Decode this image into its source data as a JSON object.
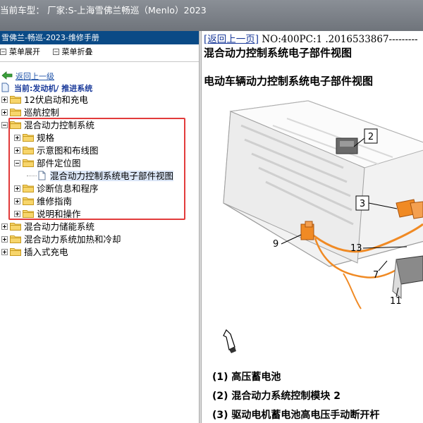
{
  "topbar": {
    "text": "当前车型： 厂家:S-上海雪佛兰畅巡（Menlo）2023"
  },
  "left": {
    "header": "雪佛兰-畅巡-2023-维修手册",
    "menu": {
      "expand": "菜单展开",
      "collapse": "菜单折叠"
    },
    "back": "返回上一级",
    "current": "当前:发动机/ 推进系统",
    "tree": [
      {
        "label": "12伏启动和充电",
        "indent": 0,
        "state": "plus",
        "selected": false
      },
      {
        "label": "巡航控制",
        "indent": 0,
        "state": "plus",
        "selected": false
      },
      {
        "label": "混合动力控制系统",
        "indent": 0,
        "state": "minus",
        "selected": false
      },
      {
        "label": "规格",
        "indent": 1,
        "state": "plus",
        "selected": false
      },
      {
        "label": "示意图和布线图",
        "indent": 1,
        "state": "plus",
        "selected": false
      },
      {
        "label": "部件定位图",
        "indent": 1,
        "state": "minus",
        "selected": false
      },
      {
        "label": "混合动力控制系统电子部件视图",
        "indent": 2,
        "state": "doc",
        "selected": true
      },
      {
        "label": "诊断信息和程序",
        "indent": 1,
        "state": "plus",
        "selected": false
      },
      {
        "label": "维修指南",
        "indent": 1,
        "state": "plus",
        "selected": false
      },
      {
        "label": "说明和操作",
        "indent": 1,
        "state": "plus",
        "selected": false
      },
      {
        "label": "混合动力储能系统",
        "indent": 0,
        "state": "plus",
        "selected": false
      },
      {
        "label": "混合动力系统加热和冷却",
        "indent": 0,
        "state": "plus",
        "selected": false
      },
      {
        "label": "插入式充电",
        "indent": 0,
        "state": "plus",
        "selected": false
      }
    ]
  },
  "right": {
    "back_link": "[返回上一页]",
    "doc_no": " NO:400PC:1 .2016533867---------",
    "title1": "混合动力控制系统电子部件视图",
    "title2": "电动车辆动力控制系统电子部件视图",
    "callouts": [
      "2",
      "3",
      "9",
      "13",
      "7",
      "11"
    ],
    "legend": [
      "(1) 高压蓄电池",
      "(2) 混合动力系统控制模块 2",
      "(3) 驱动电机蓄电池高电压手动断开杆"
    ]
  },
  "colors": {
    "header_bg": "#0a4a86",
    "selection_bg": "#dbe6f7",
    "highlight_border": "#e23b3b",
    "harness": "#f08a24"
  }
}
